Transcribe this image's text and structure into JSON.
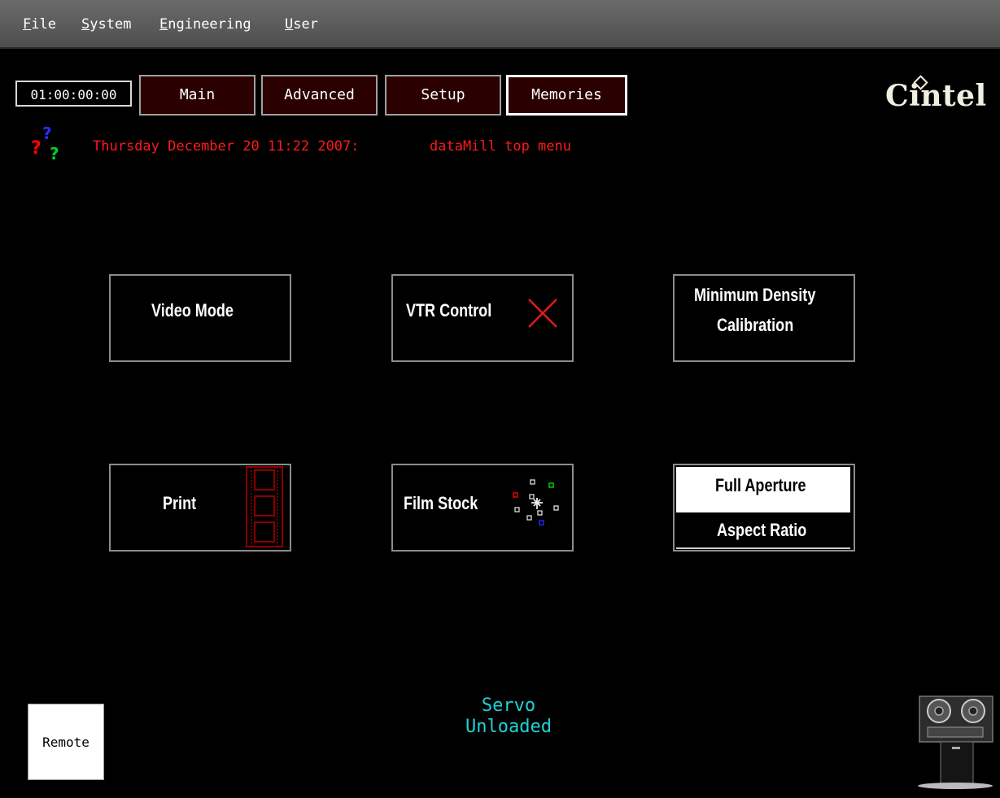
{
  "menubar": {
    "items": [
      {
        "accel": "F",
        "rest": "ile"
      },
      {
        "accel": "S",
        "rest": "ystem"
      },
      {
        "accel": "E",
        "rest": "ngineering"
      },
      {
        "accel": "U",
        "rest": "ser"
      }
    ]
  },
  "timecode": "01:00:00:00",
  "tabs": [
    {
      "label": "Main"
    },
    {
      "label": "Advanced"
    },
    {
      "label": "Setup"
    },
    {
      "label": "Memories",
      "active": true
    }
  ],
  "logo": {
    "text": "Cintel"
  },
  "status": {
    "date": "Thursday December 20 11:22 2007:",
    "menu": "dataMill top menu",
    "color": "#ff1a1a"
  },
  "panels": {
    "video_mode": "Video Mode",
    "vtr_control": "VTR Control",
    "min_density_line1": "Minimum Density",
    "min_density_line2": "Calibration",
    "print": "Print",
    "film_stock": "Film Stock",
    "full_aperture": "Full Aperture",
    "aspect_ratio": "Aspect Ratio"
  },
  "remote": "Remote",
  "servo": {
    "line1": "Servo",
    "line2": "Unloaded",
    "color": "#1fd1d6"
  },
  "icons": {
    "help": "question-marks-icon",
    "vtr_status": "red-x-icon",
    "print": "film-strip-icon",
    "film_stock": "scatter-dots-icon",
    "machine": "telecine-machine-icon"
  }
}
